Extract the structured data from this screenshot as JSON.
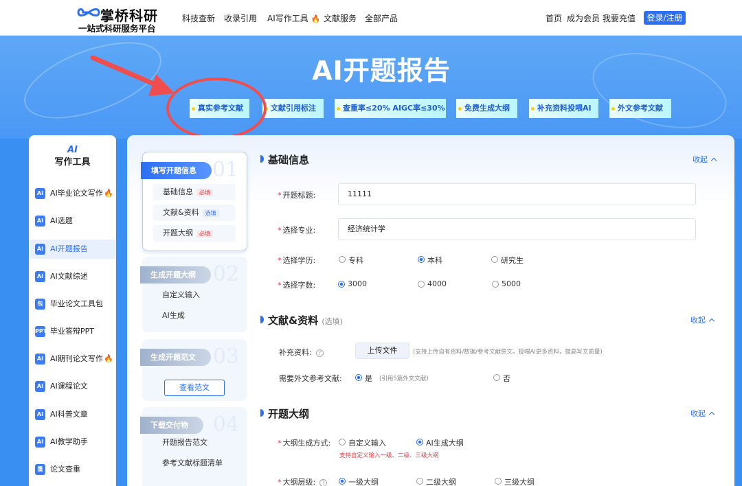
{
  "brand": {
    "name": "掌桥科研",
    "tagline": "一站式科研服务平台"
  },
  "nav": {
    "links": [
      "科技查新",
      "收录引用",
      "AI写作工具",
      "文献服务",
      "全部产品"
    ],
    "right": [
      "首页",
      "成为会员",
      "我要充值"
    ],
    "login": "登录/注册"
  },
  "hero": {
    "title": "AI开题报告",
    "tags": [
      "真实参考文献",
      "文献引用标注",
      "查重率≤20%  AIGC率≤30%",
      "免费生成大纲",
      "补充资料投喂AI",
      "外文参考文献"
    ]
  },
  "sidebar": {
    "logo": "AI",
    "title": "写作工具",
    "items": [
      {
        "label": "AI毕业论文写作",
        "icon": "AI",
        "hot": true
      },
      {
        "label": "AI选题",
        "icon": "AI",
        "hot": false
      },
      {
        "label": "AI开题报告",
        "icon": "AI",
        "hot": false,
        "active": true
      },
      {
        "label": "AI文献综述",
        "icon": "AI",
        "hot": false
      },
      {
        "label": "毕业论文工具包",
        "icon": "包",
        "hot": false
      },
      {
        "label": "毕业答辩PPT",
        "icon": "PPT",
        "hot": false
      },
      {
        "label": "AI期刊论文写作",
        "icon": "AI",
        "hot": true
      },
      {
        "label": "AI课程论文",
        "icon": "AI",
        "hot": false
      },
      {
        "label": "AI科普文章",
        "icon": "AI",
        "hot": false
      },
      {
        "label": "AI教学助手",
        "icon": "AI",
        "hot": false
      },
      {
        "label": "论文查重",
        "icon": "重",
        "hot": false
      }
    ]
  },
  "steps": [
    {
      "num": "01",
      "title": "填写开题信息",
      "subs": [
        {
          "label": "基础信息",
          "badge": "必填"
        },
        {
          "label": "文献&资料",
          "badge": "选填"
        },
        {
          "label": "开题大纲",
          "badge": "必填"
        }
      ]
    },
    {
      "num": "02",
      "title": "生成开题大纲",
      "subs": [
        {
          "label": "自定义输入"
        },
        {
          "label": "AI生成"
        }
      ]
    },
    {
      "num": "03",
      "title": "生成开题范文",
      "button": "查看范文"
    },
    {
      "num": "04",
      "title": "下载交付物",
      "subs": [
        {
          "label": "开题报告范文"
        },
        {
          "label": "参考文献标题清单"
        }
      ]
    }
  ],
  "form": {
    "collapse_label": "收起",
    "basic": {
      "title": "基础信息",
      "topic_label": "开题标题:",
      "topic_value": "11111",
      "major_label": "选择专业:",
      "major_value": "经济统计学",
      "degree_label": "选择学历:",
      "degree_options": [
        "专科",
        "本科",
        "研究生"
      ],
      "degree_selected": "本科",
      "words_label": "选择字数:",
      "words_options": [
        "3000",
        "4000",
        "5000"
      ],
      "words_selected": "3000"
    },
    "literature": {
      "title": "文献&资料",
      "note": "(选填)",
      "supplement_label": "补充资料:",
      "upload_label": "上传文件",
      "upload_note": "(支持上传自有资料/数据/参考文献原文。投喂AI更多资料，提高写文质量)",
      "foreign_label": "需要外文参考文献:",
      "yes": "是",
      "yes_note": "(引用5篇外文文献)",
      "no": "否"
    },
    "outline": {
      "title": "开题大纲",
      "method_label": "大纲生成方式:",
      "method_options": [
        "自定义输入",
        "AI生成大纲"
      ],
      "method_selected": "AI生成大纲",
      "method_note": "支持自定义输入一级、二级、三级大纲",
      "level_label": "大纲层级:",
      "level_options": [
        "一级大纲",
        "二级大纲",
        "三级大纲"
      ],
      "level_selected": "一级大纲"
    }
  },
  "colors": {
    "primary": "#2b6ff5",
    "hero": "#4a98f5",
    "annotation": "#f04e4e"
  }
}
